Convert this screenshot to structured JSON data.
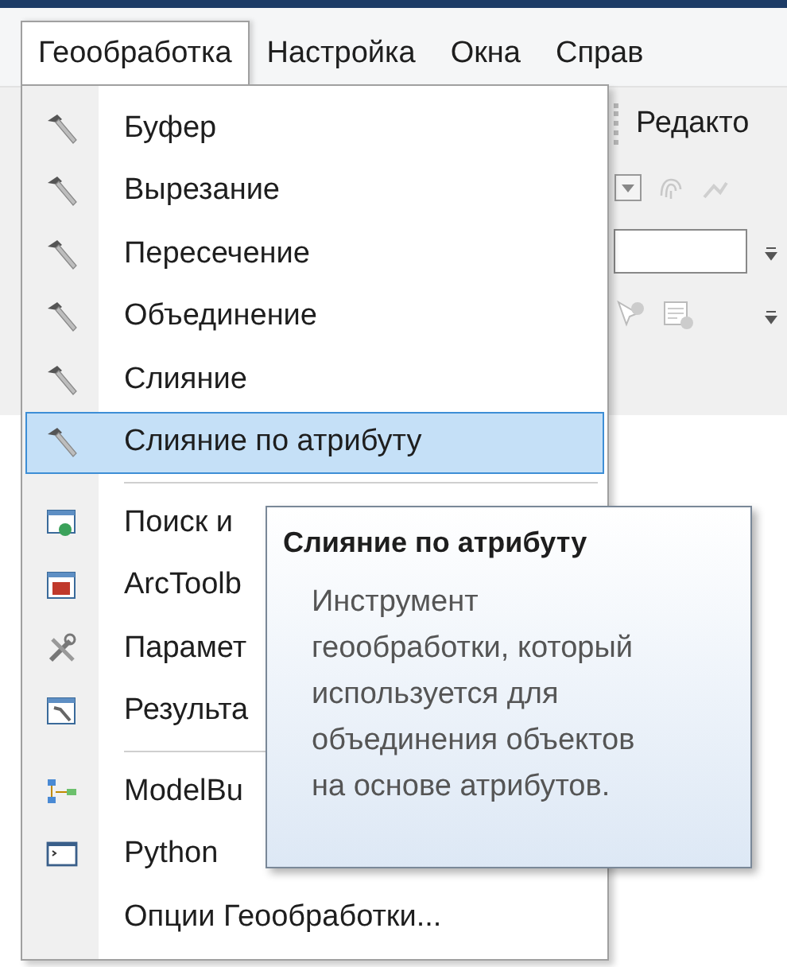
{
  "menubar": {
    "items": [
      {
        "label": "Геообработка",
        "selected": true
      },
      {
        "label": "Настройка",
        "selected": false
      },
      {
        "label": "Окна",
        "selected": false
      },
      {
        "label": "Справ",
        "selected": false
      }
    ]
  },
  "toolbar": {
    "label": "Редакто"
  },
  "menu": {
    "items": [
      {
        "kind": "tool",
        "label": "Буфер",
        "selected": false
      },
      {
        "kind": "tool",
        "label": "Вырезание",
        "selected": false
      },
      {
        "kind": "tool",
        "label": "Пересечение",
        "selected": false
      },
      {
        "kind": "tool",
        "label": "Объединение",
        "selected": false
      },
      {
        "kind": "tool",
        "label": "Слияние",
        "selected": false
      },
      {
        "kind": "tool",
        "label": "Слияние по атрибуту",
        "selected": true
      },
      {
        "kind": "separator"
      },
      {
        "kind": "search",
        "label": "Поиск и",
        "selected": false
      },
      {
        "kind": "toolbox",
        "label": "ArcToolb",
        "selected": false
      },
      {
        "kind": "settings",
        "label": "Парамет",
        "selected": false
      },
      {
        "kind": "results",
        "label": "Результа",
        "selected": false
      },
      {
        "kind": "separator"
      },
      {
        "kind": "model",
        "label": "ModelBu",
        "selected": false
      },
      {
        "kind": "python",
        "label": "Python",
        "selected": false
      },
      {
        "kind": "plain",
        "label": "Опции Геообработки...",
        "selected": false
      }
    ]
  },
  "tooltip": {
    "title": "Слияние по атрибуту",
    "text": "Инструмент\nгеообработки, который\nиспользуется для\nобъединения объектов\nна основе атрибутов."
  }
}
